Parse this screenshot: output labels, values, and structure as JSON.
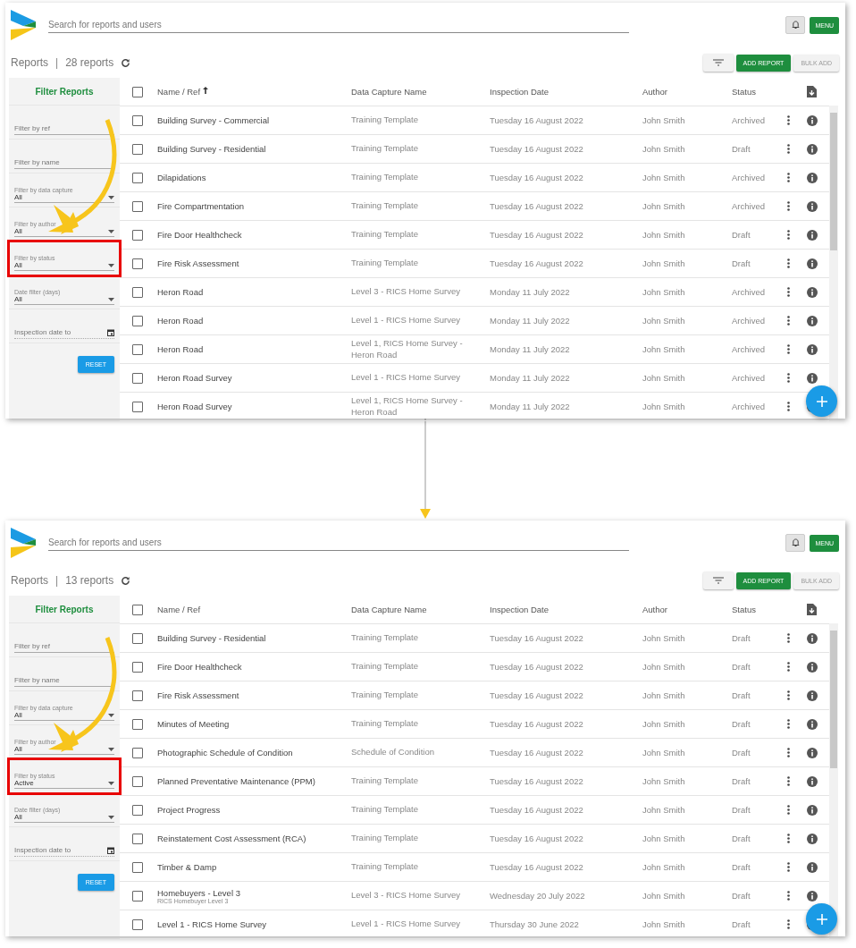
{
  "panels": [
    {
      "search": {
        "placeholder": "Search for reports and users"
      },
      "menu_button": "MENU",
      "title": "Reports",
      "separator": "|",
      "count": "28 reports",
      "select_all_checked": false,
      "add_button": "ADD REPORT",
      "bulk_button": "BULK ADD",
      "filters": {
        "title": "Filter Reports",
        "fields": [
          {
            "kind": "text",
            "placeholder": "Filter by ref",
            "highlighted": false
          },
          {
            "kind": "text",
            "placeholder": "Filter by name",
            "highlighted": false
          },
          {
            "kind": "select",
            "label": "Filter by data capture",
            "value": "All",
            "highlighted": false
          },
          {
            "kind": "select",
            "label": "Filter by author",
            "value": "All",
            "highlighted": false
          },
          {
            "kind": "select",
            "label": "Filter by status",
            "value": "All",
            "highlighted": true
          },
          {
            "kind": "select",
            "label": "Date filter (days)",
            "value": "All",
            "highlighted": false
          },
          {
            "kind": "date",
            "placeholder": "Inspection date to",
            "highlighted": false
          }
        ],
        "reset_button": "RESET"
      },
      "table": {
        "columns": [
          {
            "label": "Name / Ref",
            "sorted": true
          },
          {
            "label": "Data Capture Name",
            "sorted": false
          },
          {
            "label": "Inspection Date",
            "sorted": false
          },
          {
            "label": "Author",
            "sorted": false
          },
          {
            "label": "Status",
            "sorted": false
          }
        ],
        "rows": [
          {
            "checked": false,
            "name": "Building Survey - Commercial",
            "data_capture": "Training Template",
            "date": "Tuesday 16 August 2022",
            "author": "John Smith",
            "status": "Archived"
          },
          {
            "checked": false,
            "name": "Building Survey - Residential",
            "data_capture": "Training Template",
            "date": "Tuesday 16 August 2022",
            "author": "John Smith",
            "status": "Draft"
          },
          {
            "checked": false,
            "name": "Dilapidations",
            "data_capture": "Training Template",
            "date": "Tuesday 16 August 2022",
            "author": "John Smith",
            "status": "Archived"
          },
          {
            "checked": false,
            "name": "Fire Compartmentation",
            "data_capture": "Training Template",
            "date": "Tuesday 16 August 2022",
            "author": "John Smith",
            "status": "Archived"
          },
          {
            "checked": false,
            "name": "Fire Door Healthcheck",
            "data_capture": "Training Template",
            "date": "Tuesday 16 August 2022",
            "author": "John Smith",
            "status": "Draft"
          },
          {
            "checked": false,
            "name": "Fire Risk Assessment",
            "data_capture": "Training Template",
            "date": "Tuesday 16 August 2022",
            "author": "John Smith",
            "status": "Draft"
          },
          {
            "checked": false,
            "name": "Heron Road",
            "data_capture": "Level 3 - RICS Home Survey",
            "date": "Monday 11 July 2022",
            "author": "John Smith",
            "status": "Archived"
          },
          {
            "checked": false,
            "name": "Heron Road",
            "data_capture": "Level 1 - RICS Home Survey",
            "date": "Monday 11 July 2022",
            "author": "John Smith",
            "status": "Archived"
          },
          {
            "checked": false,
            "name": "Heron Road",
            "data_capture": "Level 1, RICS Home Survey - Heron Road",
            "date": "Monday 11 July 2022",
            "author": "John Smith",
            "status": "Archived"
          },
          {
            "checked": false,
            "name": "Heron Road Survey",
            "data_capture": "Level 1 - RICS Home Survey",
            "date": "Monday 11 July 2022",
            "author": "John Smith",
            "status": "Archived"
          },
          {
            "checked": false,
            "name": "Heron Road Survey",
            "data_capture": "Level 1, RICS Home Survey - Heron Road",
            "date": "Monday 11 July 2022",
            "author": "John Smith",
            "status": "Archived"
          }
        ]
      }
    },
    {
      "search": {
        "placeholder": "Search for reports and users"
      },
      "menu_button": "MENU",
      "title": "Reports",
      "separator": "|",
      "count": "13 reports",
      "select_all_checked": false,
      "add_button": "ADD REPORT",
      "bulk_button": "BULK ADD",
      "filters": {
        "title": "Filter Reports",
        "fields": [
          {
            "kind": "text",
            "placeholder": "Filter by ref",
            "highlighted": false
          },
          {
            "kind": "text",
            "placeholder": "Filter by name",
            "highlighted": false
          },
          {
            "kind": "select",
            "label": "Filter by data capture",
            "value": "All",
            "highlighted": false
          },
          {
            "kind": "select",
            "label": "Filter by author",
            "value": "All",
            "highlighted": false
          },
          {
            "kind": "select",
            "label": "Filter by status",
            "value": "Active",
            "highlighted": true
          },
          {
            "kind": "select",
            "label": "Date filter (days)",
            "value": "All",
            "highlighted": false
          },
          {
            "kind": "date",
            "placeholder": "Inspection date to",
            "highlighted": false
          }
        ],
        "reset_button": "RESET"
      },
      "table": {
        "columns": [
          {
            "label": "Name / Ref",
            "sorted": false
          },
          {
            "label": "Data Capture Name",
            "sorted": false
          },
          {
            "label": "Inspection Date",
            "sorted": false
          },
          {
            "label": "Author",
            "sorted": false
          },
          {
            "label": "Status",
            "sorted": false
          }
        ],
        "rows": [
          {
            "checked": false,
            "name": "Building Survey - Residential",
            "data_capture": "Training Template",
            "date": "Tuesday 16 August 2022",
            "author": "John Smith",
            "status": "Draft"
          },
          {
            "checked": false,
            "name": "Fire Door Healthcheck",
            "data_capture": "Training Template",
            "date": "Tuesday 16 August 2022",
            "author": "John Smith",
            "status": "Draft"
          },
          {
            "checked": false,
            "name": "Fire Risk Assessment",
            "data_capture": "Training Template",
            "date": "Tuesday 16 August 2022",
            "author": "John Smith",
            "status": "Draft"
          },
          {
            "checked": false,
            "name": "Minutes of Meeting",
            "data_capture": "Training Template",
            "date": "Tuesday 16 August 2022",
            "author": "John Smith",
            "status": "Draft"
          },
          {
            "checked": false,
            "name": "Photographic Schedule of Condition",
            "data_capture": "Schedule of Condition",
            "date": "Tuesday 16 August 2022",
            "author": "John Smith",
            "status": "Draft"
          },
          {
            "checked": false,
            "name": "Planned Preventative Maintenance (PPM)",
            "data_capture": "Training Template",
            "date": "Tuesday 16 August 2022",
            "author": "John Smith",
            "status": "Draft"
          },
          {
            "checked": false,
            "name": "Project Progress",
            "data_capture": "Training Template",
            "date": "Tuesday 16 August 2022",
            "author": "John Smith",
            "status": "Draft"
          },
          {
            "checked": false,
            "name": "Reinstatement Cost Assessment (RCA)",
            "data_capture": "Training Template",
            "date": "Tuesday 16 August 2022",
            "author": "John Smith",
            "status": "Draft"
          },
          {
            "checked": false,
            "name": "Timber & Damp",
            "data_capture": "Training Template",
            "date": "Tuesday 16 August 2022",
            "author": "John Smith",
            "status": "Draft"
          },
          {
            "checked": false,
            "name": "Homebuyers - Level 3",
            "ref": "RICS Homebuyer Level 3",
            "data_capture": "Level 3 - RICS Home Survey",
            "date": "Wednesday 20 July 2022",
            "author": "John Smith",
            "status": "Draft"
          },
          {
            "checked": false,
            "name": "Level 1 - RICS Home Survey",
            "data_capture": "Level 1 - RICS Home Survey",
            "date": "Thursday 30 June 2022",
            "author": "John Smith",
            "status": "Draft"
          }
        ]
      }
    }
  ]
}
